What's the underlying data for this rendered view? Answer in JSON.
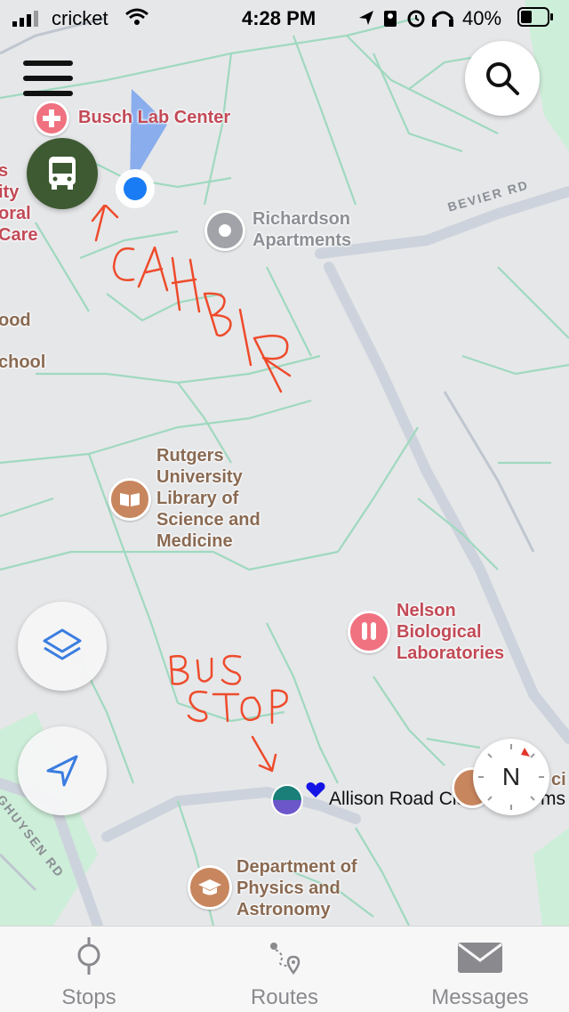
{
  "status_bar": {
    "carrier": "cricket",
    "time": "4:28 PM",
    "battery": "40%"
  },
  "map": {
    "pois": [
      {
        "id": "busch",
        "label": "Busch Lab Center",
        "icon": "medical-cross-icon",
        "color": "#f0717f"
      },
      {
        "id": "richardson",
        "label_lines": [
          "Richardson",
          "Apartments"
        ],
        "icon": "residence-icon",
        "color": "#9a9a9e"
      },
      {
        "id": "library",
        "label_lines": [
          "Rutgers",
          "University",
          "Library of",
          "Science and",
          "Medicine"
        ],
        "icon": "book-icon",
        "color": "#c8865e"
      },
      {
        "id": "nelson",
        "label_lines": [
          "Nelson",
          "Biological",
          "Laboratories"
        ],
        "icon": "lab-icon",
        "color": "#f0717f"
      },
      {
        "id": "physics",
        "label_lines": [
          "Department of",
          "Physics and",
          "Astronomy"
        ],
        "icon": "graduation-cap-icon",
        "color": "#c8865e"
      }
    ],
    "left_edge_labels": [
      "s",
      "ity",
      "oral",
      "Care",
      "ood",
      "chool"
    ],
    "right_edge_label": "ci",
    "streets": [
      "BEVIER RD",
      "GHUYSEN RD"
    ],
    "bus_stop": {
      "name_label": "Allison Road Cla",
      "name_tail": "ms"
    },
    "annotations": [
      "CAHBIR",
      "BUS",
      "STOP"
    ],
    "compass_label": "N",
    "accent": "#1a7cf5"
  },
  "tabs": [
    {
      "label": "Stops",
      "icon": "stop-pin-icon"
    },
    {
      "label": "Routes",
      "icon": "route-icon"
    },
    {
      "label": "Messages",
      "icon": "envelope-icon"
    }
  ]
}
